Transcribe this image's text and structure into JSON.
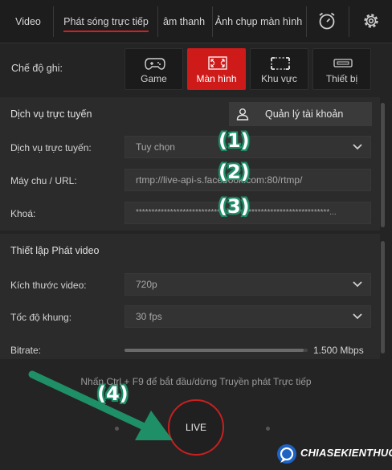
{
  "tabs": [
    {
      "label": "Video"
    },
    {
      "label": "Phát sóng trực tiếp"
    },
    {
      "label": "âm thanh"
    },
    {
      "label": "Ảnh chụp màn hình"
    }
  ],
  "nav_icons": [
    "timer-icon",
    "gear-icon"
  ],
  "mode": {
    "label": "Chế độ ghi:",
    "buttons": [
      {
        "label": "Game",
        "icon": "gamepad-icon"
      },
      {
        "label": "Màn hình",
        "icon": "fullscreen-icon",
        "active": true
      },
      {
        "label": "Khu vực",
        "icon": "region-icon"
      },
      {
        "label": "Thiết bị",
        "icon": "device-icon"
      }
    ]
  },
  "online_service": {
    "title": "Dịch vụ trực tuyến",
    "account_button": "Quản lý tài khoản",
    "service_label": "Dịch vụ trực tuyến:",
    "service_value": "Tuy chọn",
    "url_label": "Máy chu / URL:",
    "url_value": "rtmp://live-api-s.facebook.com:80/rtmp/",
    "key_label": "Khoá:",
    "key_value": "**************************************************************..."
  },
  "video_settings": {
    "title": "Thiết lập Phát video",
    "size_label": "Kích thước video:",
    "size_value": "720p",
    "fps_label": "Tốc độ khung:",
    "fps_value": "30 fps",
    "bitrate_label": "Bitrate:",
    "bitrate_value": "1.500 Mbps",
    "bitrate_level": 0.98
  },
  "annotations": [
    "(1)",
    "(2)",
    "(3)",
    "(4)"
  ],
  "hint": "Nhấn Ctrl + F9 để bắt đầu/dừng Truyền phát Trực tiếp",
  "live_label": "LIVE",
  "watermark": "CHIASEKIENTHUC",
  "colors": {
    "accent": "#cf1a1a",
    "annotation": "#1e8f67"
  }
}
